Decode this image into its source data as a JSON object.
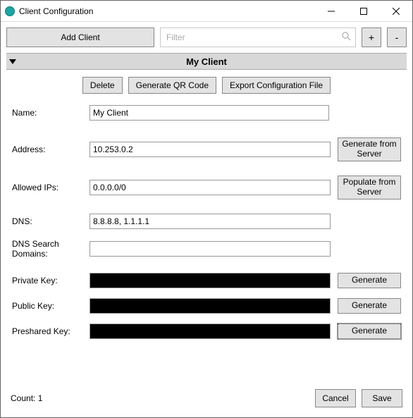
{
  "window": {
    "title": "Client Configuration"
  },
  "toolbar": {
    "add_client_label": "Add Client",
    "filter_placeholder": "Filter",
    "add_symbol": "+",
    "remove_symbol": "-"
  },
  "section": {
    "title": "My Client"
  },
  "actions": {
    "delete": "Delete",
    "generate_qr": "Generate QR Code",
    "export_config": "Export Configuration File"
  },
  "form": {
    "name": {
      "label": "Name:",
      "value": "My Client"
    },
    "address": {
      "label": "Address:",
      "value": "10.253.0.2",
      "side_line1": "Generate from",
      "side_line2": "Server"
    },
    "allowed_ips": {
      "label": "Allowed IPs:",
      "value": "0.0.0.0/0",
      "side_line1": "Populate from",
      "side_line2": "Server"
    },
    "dns": {
      "label": "DNS:",
      "value": "8.8.8.8, 1.1.1.1"
    },
    "dns_search": {
      "label_line1": "DNS Search",
      "label_line2": "Domains:",
      "value": ""
    },
    "private_key": {
      "label": "Private Key:",
      "value": "",
      "side": "Generate"
    },
    "public_key": {
      "label": "Public Key:",
      "value": "",
      "side": "Generate"
    },
    "preshared_key": {
      "label": "Preshared Key:",
      "value": "",
      "side": "Generate"
    }
  },
  "footer": {
    "count_label": "Count: 1",
    "cancel": "Cancel",
    "save": "Save"
  }
}
